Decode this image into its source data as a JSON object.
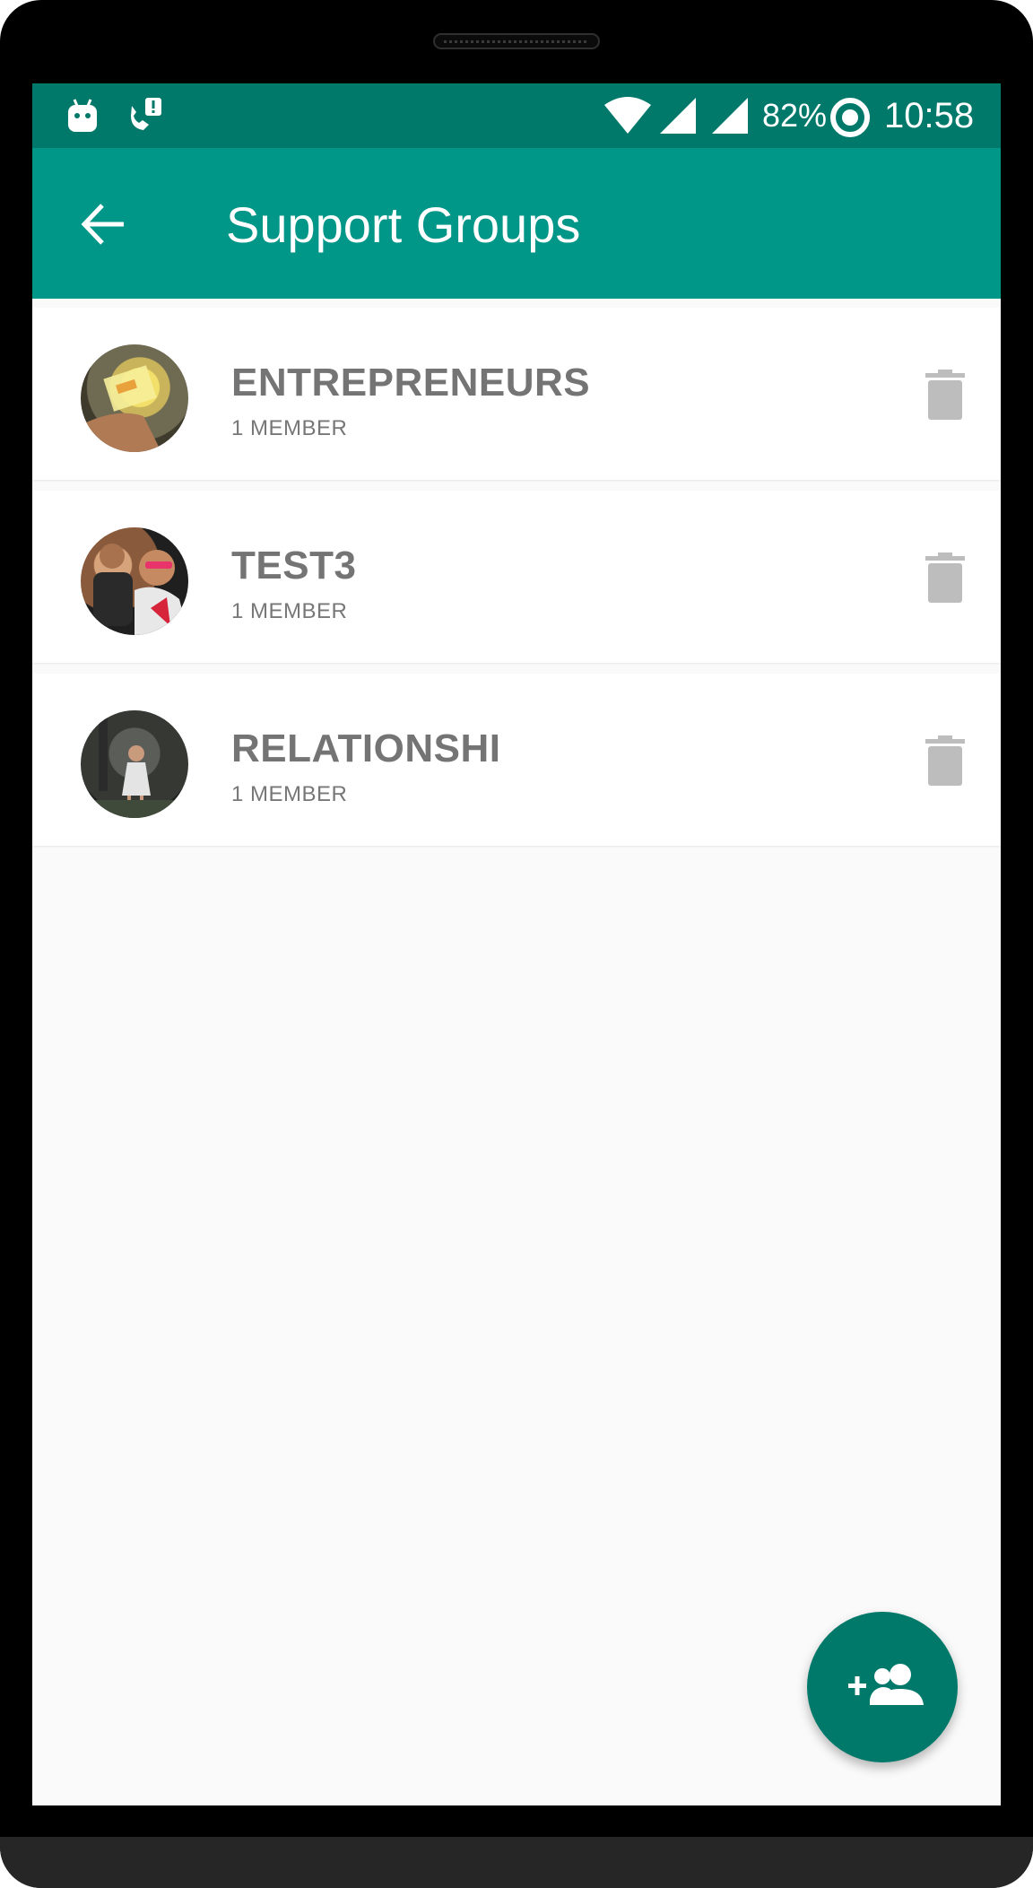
{
  "status_bar": {
    "battery_percent": "82%",
    "time": "10:58",
    "icons": [
      "android-icon",
      "missed-call-icon",
      "wifi-icon",
      "signal-icon",
      "signal-icon",
      "battery-saver-icon"
    ]
  },
  "app_bar": {
    "title": "Support Groups",
    "back_icon": "arrow-back-icon"
  },
  "groups": [
    {
      "name": "ENTREPRENEURS",
      "members": "1 MEMBER",
      "action_icon": "delete-icon"
    },
    {
      "name": "TEST3",
      "members": "1 MEMBER",
      "action_icon": "delete-icon"
    },
    {
      "name": "RELATIONSHI",
      "members": "1 MEMBER",
      "action_icon": "delete-icon"
    }
  ],
  "fab": {
    "icon": "add-group-icon"
  },
  "colors": {
    "status_bar": "#00796b",
    "app_bar": "#009688",
    "fab": "#00796b",
    "background": "#fafafa"
  }
}
